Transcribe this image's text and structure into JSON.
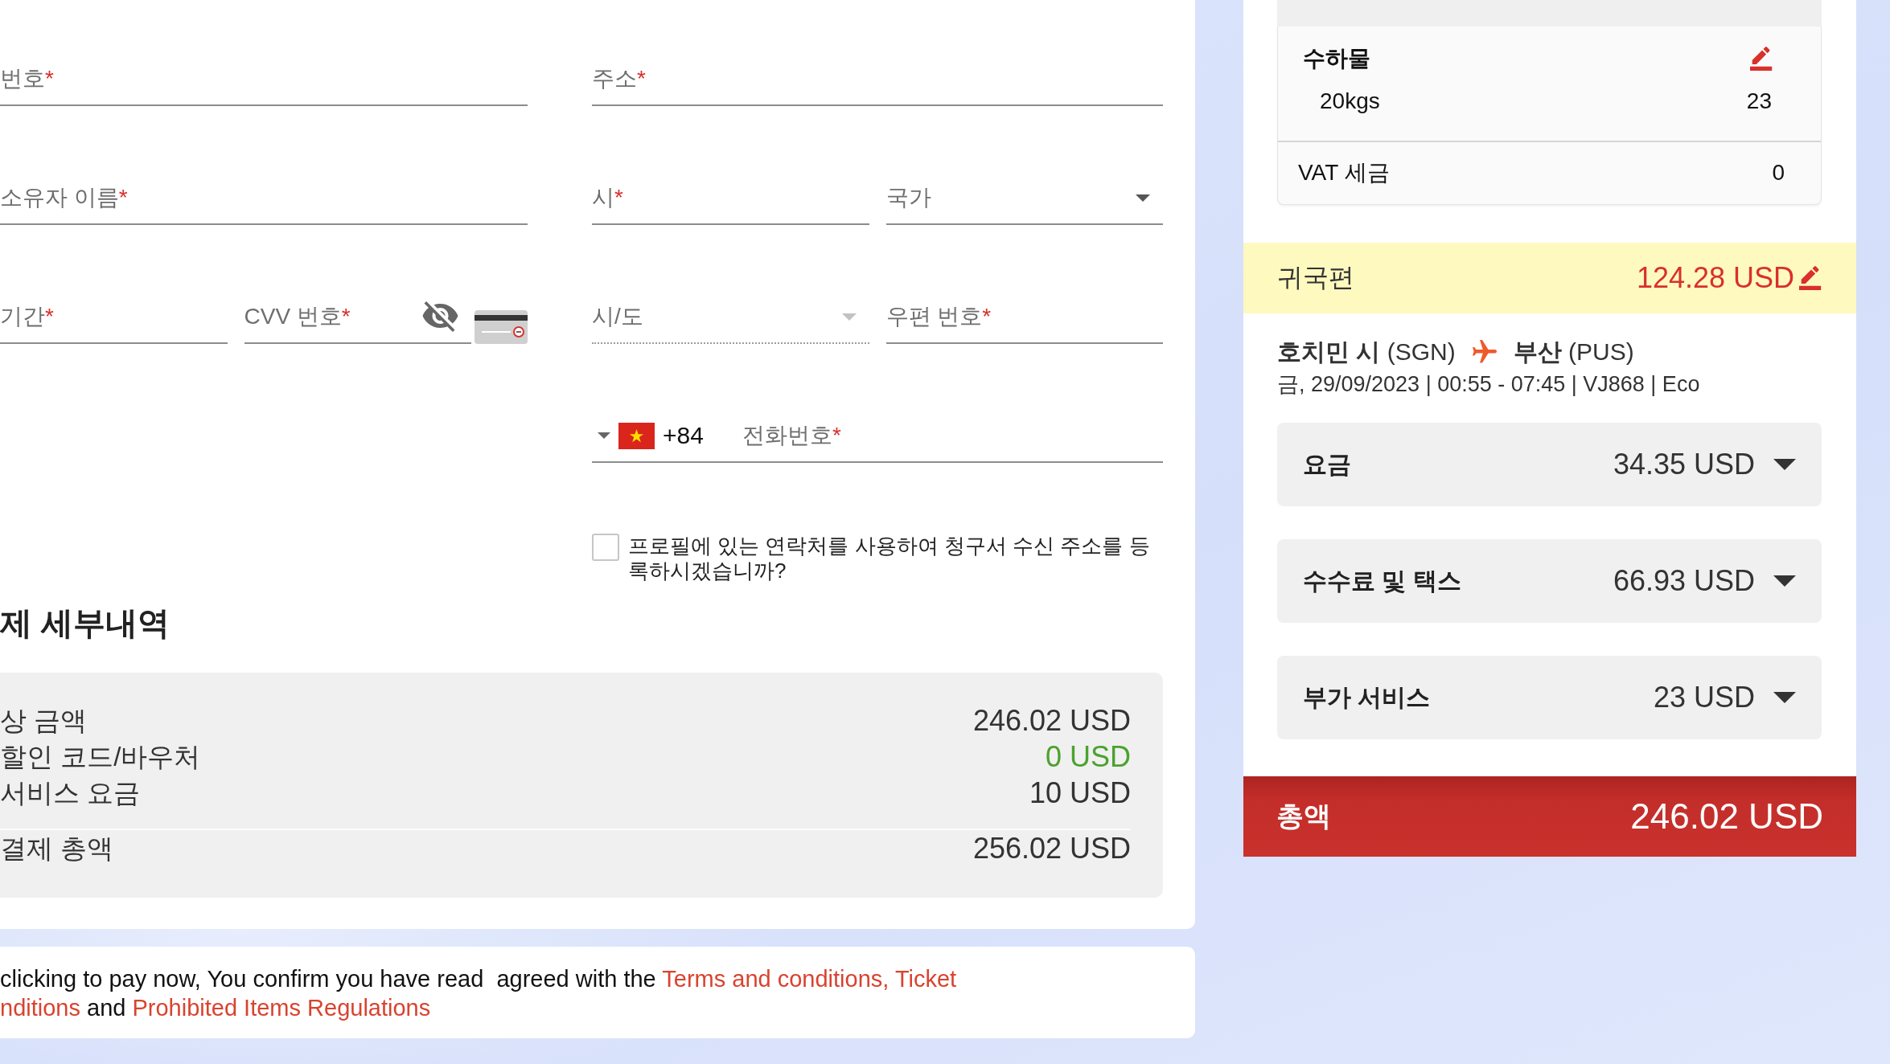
{
  "card_details": {
    "rows": [
      {
        "fields": [
          {
            "kind": "text",
            "placeholder": "번호",
            "required_mark": "*",
            "disabled": false
          }
        ]
      },
      {
        "fields": [
          {
            "kind": "text",
            "placeholder": "소유자 이름",
            "required_mark": "*",
            "disabled": false
          }
        ]
      },
      {
        "fields": [
          {
            "kind": "text",
            "placeholder": "기간",
            "required_mark": "*",
            "disabled": false
          },
          {
            "kind": "secret",
            "placeholder": "CVV 번호",
            "required_mark": "*",
            "disabled": false
          }
        ]
      }
    ]
  },
  "billing_address": {
    "rows": [
      {
        "fields": [
          {
            "kind": "text",
            "placeholder": "주소",
            "required_mark": "*",
            "disabled": false
          }
        ]
      },
      {
        "fields": [
          {
            "kind": "text",
            "placeholder": "시",
            "required_mark": "*",
            "disabled": false
          },
          {
            "kind": "select",
            "placeholder": "국가",
            "disabled": false
          }
        ]
      },
      {
        "fields": [
          {
            "kind": "select",
            "placeholder": "시/도",
            "disabled": true
          },
          {
            "kind": "text",
            "placeholder": "우편 번호",
            "required_mark": "*",
            "disabled": false
          }
        ]
      },
      {
        "fields": [
          {
            "kind": "phone",
            "country_code": "+84",
            "placeholder": "전화번호",
            "required_mark": "*",
            "disabled": false
          }
        ]
      }
    ],
    "consent": {
      "label": "프로필에 있는 연락처를 사용하여 청구서 수신 주소를 등록하시겠습니까?",
      "checked": false
    }
  },
  "payment_details": {
    "title": "제 세부내역",
    "rows": [
      {
        "kind": "amount",
        "label": "상 금액",
        "amount": "246.02 USD"
      },
      {
        "kind": "discount",
        "label": "할인 코드/바우처",
        "amount": "0 USD"
      },
      {
        "kind": "amount",
        "label": "서비스 요금",
        "amount": "10 USD"
      },
      {
        "kind": "total",
        "label": "결제 총액",
        "amount": "256.02 USD"
      }
    ]
  },
  "terms": {
    "lines": [
      [
        {
          "kind": "text",
          "text": "clicking to pay now, You confirm you have read  agreed with the "
        },
        {
          "kind": "link",
          "text": "Terms and conditions, Ticket"
        }
      ],
      [
        {
          "kind": "link",
          "text": "nditions"
        },
        {
          "kind": "text",
          "text": " and "
        },
        {
          "kind": "link",
          "text": "Prohibited Items Regulations"
        }
      ]
    ]
  },
  "booking_summary": {
    "baggage": {
      "title": "수하물",
      "items": [
        {
          "label": "20kgs",
          "value": "23"
        }
      ],
      "vat": {
        "label": "VAT 세금",
        "value": "0"
      }
    },
    "return_flight": {
      "title": "귀국편",
      "price": "124.28 USD",
      "route": {
        "from": "**호치민 시** (SGN)",
        "to": "**부산** (PUS)"
      },
      "schedule": "금, 29/09/2023 | 00:55 - 07:45 | VJ868 | Eco",
      "breakdown": [
        {
          "label": "요금",
          "amount": "34.35 USD",
          "expanded": false
        },
        {
          "label": "수수료 및 택스",
          "amount": "66.93 USD",
          "expanded": false
        },
        {
          "label": "부가 서비스",
          "amount": "23 USD",
          "expanded": false
        }
      ]
    },
    "total": {
      "label": "총액",
      "amount": "246.02 USD"
    }
  }
}
